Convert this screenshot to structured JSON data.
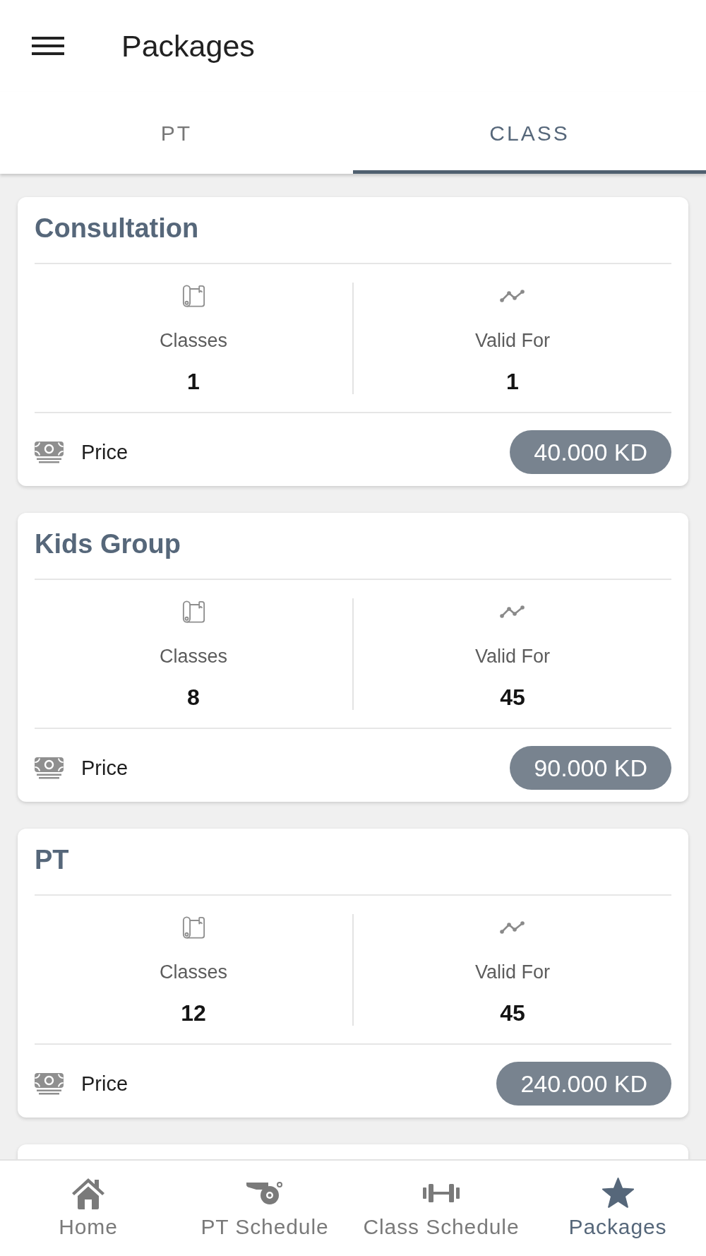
{
  "app_bar": {
    "title": "Packages"
  },
  "tabs": [
    {
      "label": "PT",
      "selected": false
    },
    {
      "label": "CLASS",
      "selected": true
    }
  ],
  "packages": [
    {
      "name": "Consultation",
      "stats": [
        {
          "kind": "classes",
          "label": "Classes",
          "value": "1"
        },
        {
          "kind": "validity",
          "label": "Valid For",
          "value": "1"
        }
      ],
      "price_label": "Price",
      "price": "40.000 KD"
    },
    {
      "name": "Kids Group",
      "stats": [
        {
          "kind": "classes",
          "label": "Classes",
          "value": "8"
        },
        {
          "kind": "validity",
          "label": "Valid For",
          "value": "45"
        }
      ],
      "price_label": "Price",
      "price": "90.000 KD"
    },
    {
      "name": "PT",
      "stats": [
        {
          "kind": "classes",
          "label": "Classes",
          "value": "12"
        },
        {
          "kind": "validity",
          "label": "Valid For",
          "value": "45"
        }
      ],
      "price_label": "Price",
      "price": "240.000 KD"
    }
  ],
  "bottom_nav": [
    {
      "kind": "home",
      "label": "Home",
      "selected": false
    },
    {
      "kind": "pt_schedule",
      "label": "PT Schedule",
      "selected": false
    },
    {
      "kind": "class_schedule",
      "label": "Class Schedule",
      "selected": false
    },
    {
      "kind": "packages",
      "label": "Packages",
      "selected": true
    }
  ]
}
